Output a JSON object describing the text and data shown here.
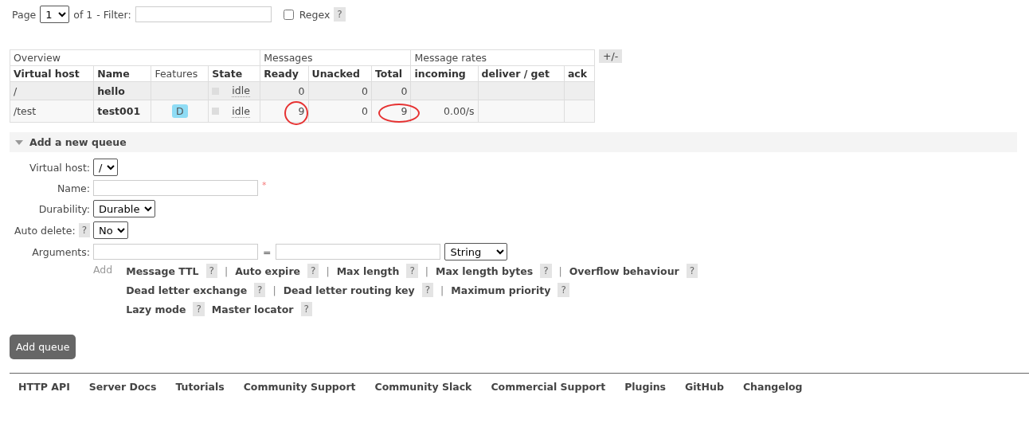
{
  "paging": {
    "label": "Page",
    "page": "1",
    "of": "of 1",
    "filter_label": "- Filter:",
    "regex_label": "Regex",
    "regex_checked": false,
    "help": "?"
  },
  "queues_table": {
    "groups": [
      {
        "label": "Overview",
        "columns": [
          {
            "label": "Virtual host",
            "bold": true
          },
          {
            "label": "Name",
            "bold": true
          },
          {
            "label": "Features",
            "bold": false
          },
          {
            "label": "State",
            "bold": true
          }
        ]
      },
      {
        "label": "Messages",
        "columns": [
          {
            "label": "Ready",
            "bold": true
          },
          {
            "label": "Unacked",
            "bold": true
          },
          {
            "label": "Total",
            "bold": true
          }
        ]
      },
      {
        "label": "Message rates",
        "columns": [
          {
            "label": "incoming",
            "bold": true
          },
          {
            "label": "deliver / get",
            "bold": true
          },
          {
            "label": "ack",
            "bold": true
          }
        ]
      }
    ],
    "toggle": "+/-",
    "rows": [
      {
        "vhost": "/",
        "name": "hello",
        "state": "idle",
        "ready": {
          "text": "0",
          "circled": false
        },
        "unacked": {
          "text": "0",
          "circled": false
        },
        "total": {
          "text": "0",
          "circled": false
        }
      },
      {
        "vhost": "/test",
        "name": "test001",
        "feature": "D",
        "state": "idle",
        "ready": {
          "text": "9",
          "circled": true
        },
        "unacked": {
          "text": "0",
          "circled": false
        },
        "total": {
          "text": "9",
          "circled": true
        },
        "incoming": "0.00/s"
      }
    ]
  },
  "add_queue": {
    "title": "Add a new queue",
    "expanded": true,
    "fields": [
      {
        "kind": "select",
        "label": "Virtual host:",
        "value": "/"
      },
      {
        "kind": "text",
        "label": "Name:",
        "required": "*"
      },
      {
        "kind": "select",
        "label": "Durability:",
        "value": "Durable"
      },
      {
        "kind": "select",
        "label": "Auto delete:",
        "help": "?",
        "value": "No"
      },
      {
        "kind": "arguments",
        "label": "Arguments:",
        "equals": "=",
        "value": "String"
      }
    ],
    "add_label": "Add",
    "argument_lines": [
      [
        {
          "label": "Message TTL",
          "help": "?",
          "separator": "|"
        },
        {
          "label": "Auto expire",
          "help": "?",
          "separator": "|"
        },
        {
          "label": "Max length",
          "help": "?",
          "separator": "|"
        },
        {
          "label": "Max length bytes",
          "help": "?",
          "separator": "|"
        },
        {
          "label": "Overflow behaviour",
          "help": "?"
        }
      ],
      [
        {
          "label": "Dead letter exchange",
          "help": "?",
          "separator": "|"
        },
        {
          "label": "Dead letter routing key",
          "help": "?",
          "separator": "|"
        },
        {
          "label": "Maximum priority",
          "help": "?"
        }
      ],
      [
        {
          "label": "Lazy mode",
          "help": "?"
        },
        {
          "label": "Master locator",
          "help": "?"
        }
      ]
    ],
    "submit": "Add queue"
  },
  "footer_links": [
    "HTTP API",
    "Server Docs",
    "Tutorials",
    "Community Support",
    "Community Slack",
    "Commercial Support",
    "Plugins",
    "GitHub",
    "Changelog"
  ]
}
